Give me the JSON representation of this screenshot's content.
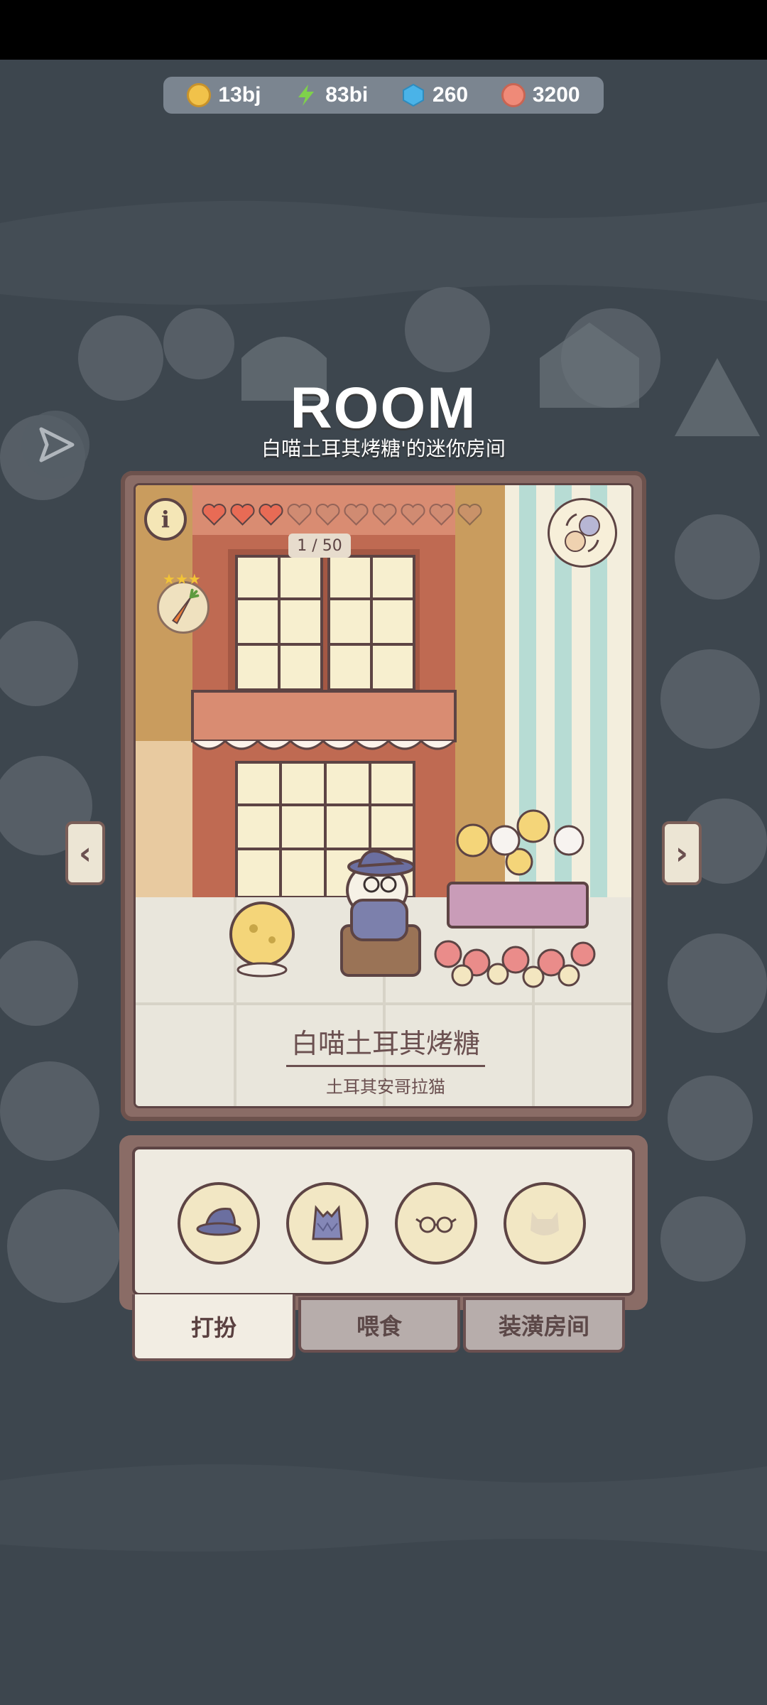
{
  "resources": [
    {
      "icon": "coin-icon",
      "value": "13bj",
      "color": "#f1c24a"
    },
    {
      "icon": "lightning-icon",
      "value": "83bi",
      "color": "#7fd14b"
    },
    {
      "icon": "gem-icon",
      "value": "260",
      "color": "#4ab3e8"
    },
    {
      "icon": "paw-icon",
      "value": "3200",
      "color": "#ef8a78"
    }
  ],
  "room": {
    "title": "ROOM",
    "subtitle": "白喵土耳其烤糖'的迷你房间",
    "affection": "1 / 50",
    "affection_hearts_filled": 3,
    "affection_hearts_total": 10,
    "cat_name": "白喵土耳其烤糖",
    "cat_breed": "土耳其安哥拉猫",
    "food_stars": 3
  },
  "tabs": {
    "dress": "打扮",
    "feed": "喂食",
    "decorate": "装潢房间"
  },
  "outfit_slots": [
    "hat-icon",
    "vest-icon",
    "glasses-icon",
    "accessory-icon"
  ]
}
